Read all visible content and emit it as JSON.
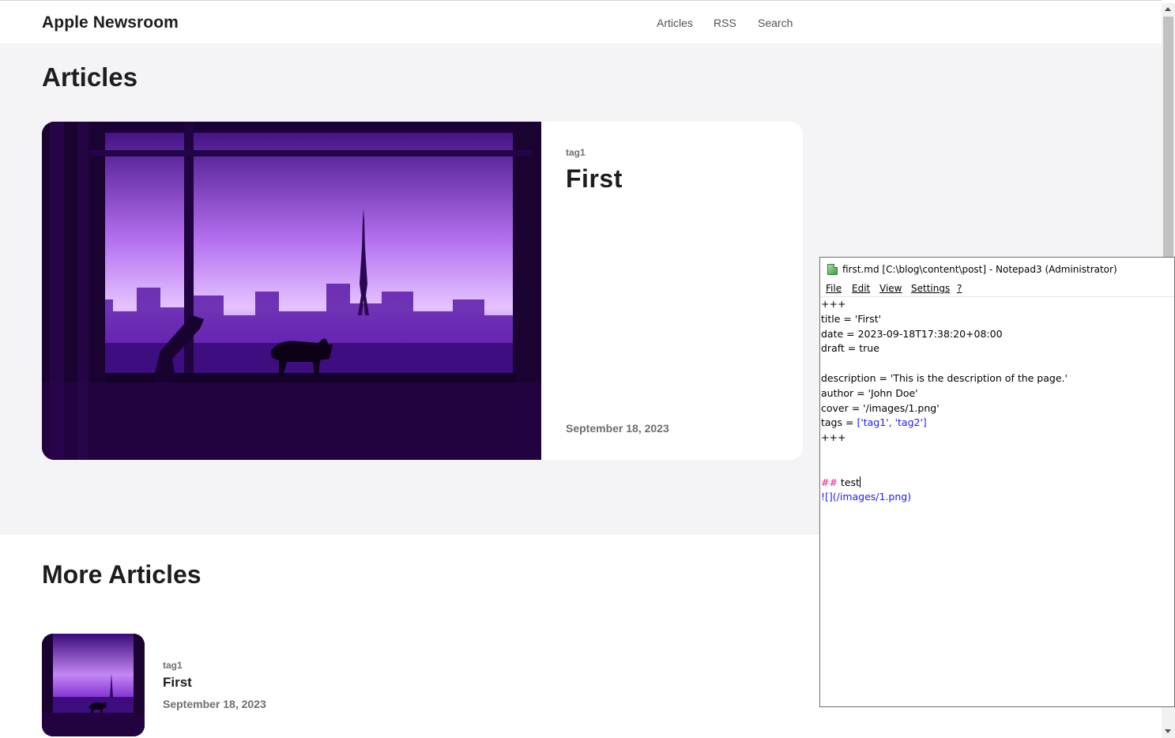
{
  "site": {
    "brand": "Apple Newsroom",
    "nav": [
      "Articles",
      "RSS",
      "Search"
    ]
  },
  "hero": {
    "title": "Articles",
    "featured": {
      "tag": "tag1",
      "title": "First",
      "date": "September 18, 2023",
      "image_icon": "night-city-cat-image"
    }
  },
  "more": {
    "title": "More Articles",
    "items": [
      {
        "tag": "tag1",
        "title": "First",
        "date": "September 18, 2023"
      }
    ]
  },
  "notepad": {
    "title": "first.md [C:\\blog\\content\\post] - Notepad3 (Administrator)",
    "menu": [
      "File",
      "Edit",
      "View",
      "Settings",
      "?"
    ],
    "lines": {
      "l1": "+++",
      "l2": "title = 'First'",
      "l3": "date = 2023-09-18T17:38:20+08:00",
      "l4": "draft = true",
      "l6": "description = 'This is the description of the page.'",
      "l7": "author = 'John Doe'",
      "l8": "cover = '/images/1.png'",
      "l9_key": "tags = ",
      "l9_val": "['tag1', 'tag2']",
      "l10": "+++",
      "l13_hash": "##",
      "l13_text": " test",
      "l14": "![](/images/1.png)"
    }
  },
  "colors": {
    "accent_purple": "#7a2bd1",
    "hero_bg": "#f4f4f6",
    "markdown_link": "#1a1aff",
    "markdown_heading": "#ff1493"
  }
}
